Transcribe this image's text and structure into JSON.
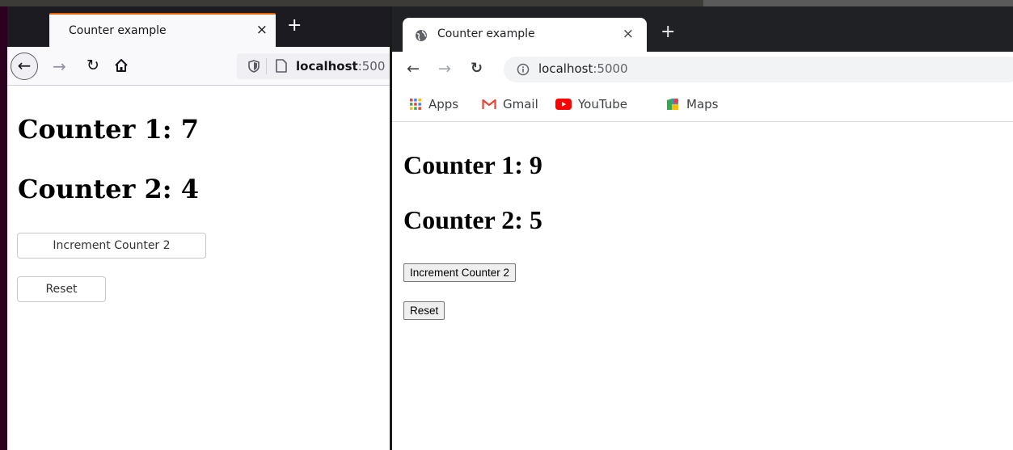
{
  "firefox": {
    "tab_title": "Counter example",
    "tab_close": "×",
    "new_tab": "+",
    "url_host": "localhost",
    "url_port": ":500",
    "counter1": "Counter 1: 7",
    "counter2": "Counter 2: 4",
    "increment_label": "Increment Counter 2",
    "reset_label": "Reset"
  },
  "chrome": {
    "tab_title": "Counter example",
    "tab_close": "×",
    "new_tab": "+",
    "url_host": "localhost",
    "url_port": ":5000",
    "bookmarks": [
      "Apps",
      "Gmail",
      "YouTube",
      "Maps"
    ],
    "counter1": "Counter 1: 9",
    "counter2": "Counter 2: 5",
    "increment_label": "Increment Counter 2",
    "reset_label": "Reset"
  },
  "colors": {
    "firefox_tab_accent": "#e66000",
    "chrome_tabbar": "#202124",
    "firefox_tabbar": "#1c1b22"
  }
}
